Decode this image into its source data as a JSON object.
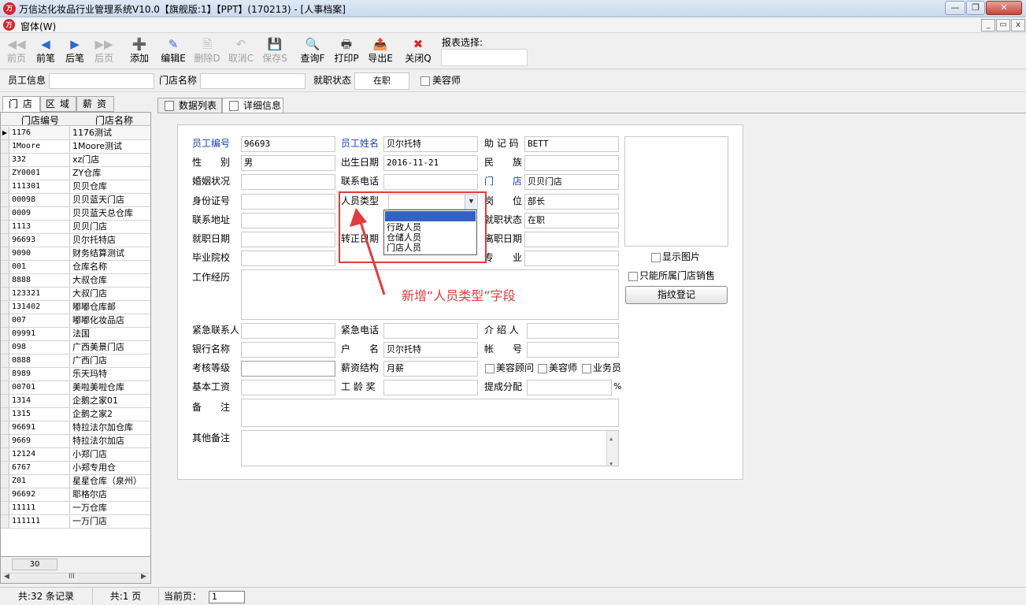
{
  "window": {
    "title": "万信达化妆品行业管理系统V10.0【旗舰版:1】【PPT】(170213) - [人事档案]",
    "logo_text": "万",
    "minimize": "—",
    "restore": "❐",
    "close": "✕"
  },
  "menubar": {
    "menu_label": "窗体(W)",
    "mdi_minimize": "_",
    "mdi_restore": "▭",
    "mdi_close": "x"
  },
  "toolbar": {
    "buttons": [
      {
        "label": "前页",
        "icon": "◀◀",
        "icon_name": "first-page-icon"
      },
      {
        "label": "前笔",
        "icon": "◀",
        "icon_name": "prev-record-icon"
      },
      {
        "label": "后笔",
        "icon": "▶",
        "icon_name": "next-record-icon"
      },
      {
        "label": "后页",
        "icon": "▶▶",
        "icon_name": "last-page-icon"
      },
      {
        "label": "添加",
        "icon": "➕",
        "icon_name": "add-icon"
      },
      {
        "label": "编辑E",
        "icon": "✎",
        "icon_name": "edit-icon"
      },
      {
        "label": "删除D",
        "icon": "🗎",
        "icon_name": "delete-icon"
      },
      {
        "label": "取消C",
        "icon": "↶",
        "icon_name": "undo-icon"
      },
      {
        "label": "保存S",
        "icon": "💾",
        "icon_name": "save-icon"
      },
      {
        "label": "查询F",
        "icon": "🔍",
        "icon_name": "search-icon"
      },
      {
        "label": "打印P",
        "icon": "🖶",
        "icon_name": "print-icon"
      },
      {
        "label": "导出E",
        "icon": "📤",
        "icon_name": "export-icon"
      },
      {
        "label": "关闭Q",
        "icon": "✖",
        "icon_name": "close-icon"
      }
    ],
    "report_label": "报表选择:"
  },
  "filter": {
    "employee_label": "员工信息",
    "store_label": "门店名称",
    "status_label": "就职状态",
    "status_value": "在职",
    "beautician_label": "美容师"
  },
  "left_tabs": [
    "门店",
    "区域",
    "薪资"
  ],
  "store_grid": {
    "headers": [
      "门店编号",
      "门店名称"
    ],
    "rows": [
      [
        "1176",
        "1176测试"
      ],
      [
        "1Moore",
        "1Moore测试"
      ],
      [
        "332",
        "xz门店"
      ],
      [
        "ZY0001",
        "ZY仓库"
      ],
      [
        "111301",
        "贝贝仓库"
      ],
      [
        "00098",
        "贝贝蓝天门店"
      ],
      [
        "0009",
        "贝贝蓝天总仓库"
      ],
      [
        "1113",
        "贝贝门店"
      ],
      [
        "96693",
        "贝尔托特店"
      ],
      [
        "9090",
        "财务结算测试"
      ],
      [
        "001",
        "仓库名称"
      ],
      [
        "8888",
        "大叔仓库"
      ],
      [
        "123321",
        "大叔门店"
      ],
      [
        "131402",
        "嘟嘟仓库邮"
      ],
      [
        "007",
        "嘟嘟化妆品店"
      ],
      [
        "09991",
        "法国"
      ],
      [
        "098",
        "广西美景门店"
      ],
      [
        "0888",
        "广西门店"
      ],
      [
        "8989",
        "乐天玛特"
      ],
      [
        "00701",
        "美啦美啦仓库"
      ],
      [
        "1314",
        "企鹅之家01"
      ],
      [
        "1315",
        "企鹅之家2"
      ],
      [
        "96691",
        "特拉法尔加仓库"
      ],
      [
        "9669",
        "特拉法尔加店"
      ],
      [
        "12124",
        "小郑门店"
      ],
      [
        "6767",
        "小郑专用仓"
      ],
      [
        "Z01",
        "星星仓库（泉州）"
      ],
      [
        "96692",
        "耶格尔店"
      ],
      [
        "11111",
        "一万仓库"
      ],
      [
        "111111",
        "一万门店"
      ]
    ],
    "footer_count": "30",
    "scroll_thumb": "III"
  },
  "right_tabs": [
    "数据列表",
    "详细信息"
  ],
  "form": {
    "emp_no_label": "员工编号",
    "emp_no": "96693",
    "emp_name_label": "员工姓名",
    "emp_name": "贝尔托特",
    "mnemonic_label": "助 记 码",
    "mnemonic": "BETT",
    "gender_label": "性　　别",
    "gender": "男",
    "birth_label": "出生日期",
    "birth": "2016-11-21",
    "nation_label": "民　　族",
    "marital_label": "婚姻状况",
    "phone_label": "联系电话",
    "store_label": "门　　店",
    "store": "贝贝门店",
    "idcard_label": "身份证号",
    "staff_type_label": "人员类型",
    "position_label": "岗　　位",
    "position": "部长",
    "address_label": "联系地址",
    "status_label": "就职状态",
    "status": "在职",
    "hire_label": "就职日期",
    "regular_label": "转正日期",
    "leave_label": "离职日期",
    "school_label": "毕业院校",
    "major_label": "专　　业",
    "work_exp_label": "工作经历",
    "emergency_contact_label": "紧急联系人",
    "emergency_phone_label": "紧急电话",
    "referrer_label": "介 绍 人",
    "bank_label": "银行名称",
    "account_name_label": "户　　名",
    "account_name": "贝尔托特",
    "account_no_label": "帐　　号",
    "grade_label": "考核等级",
    "salary_struct_label": "薪资结构",
    "salary_struct": "月薪",
    "consultant_label": "美容顾问",
    "beautician_label": "美容师",
    "salesman_label": "业务员",
    "base_salary_label": "基本工资",
    "seniority_label": "工 龄 奖",
    "commission_label": "提成分配",
    "percent": "%",
    "remark_label": "备　　注",
    "other_remark_label": "其他备注",
    "show_photo_label": "显示图片",
    "own_store_label": "只能所属门店销售",
    "fingerprint_button": "指纹登记"
  },
  "dropdown": {
    "options": [
      "行政人员",
      "仓储人员",
      "门店人员"
    ],
    "arrow": "▼"
  },
  "annotation": "新增“人员类型”字段",
  "colors": {
    "highlight": "#e23b3b",
    "selection": "#3362c6",
    "label_blue": "#1a3fb6"
  },
  "status": {
    "records": "共:32 条记录",
    "pages": "共:1 页",
    "current_page_label": "当前页：",
    "current_page": "1"
  }
}
